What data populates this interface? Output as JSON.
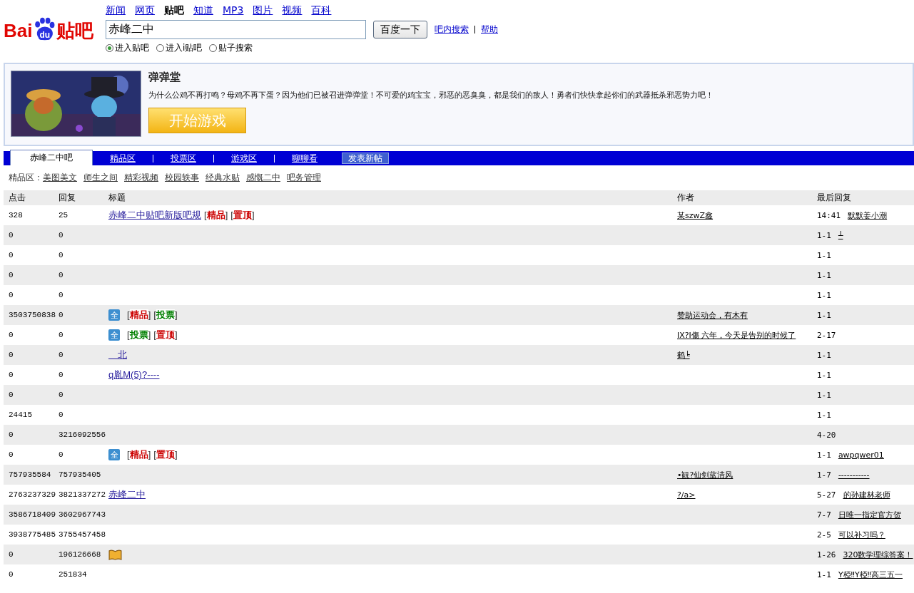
{
  "logo": {
    "left": "Bai",
    "paw": "du",
    "right": "贴吧"
  },
  "nav": [
    {
      "label": "新闻",
      "selected": false
    },
    {
      "label": "网页",
      "selected": false
    },
    {
      "label": "贴吧",
      "selected": true
    },
    {
      "label": "知道",
      "selected": false
    },
    {
      "label": "MP3",
      "selected": false
    },
    {
      "label": "图片",
      "selected": false
    },
    {
      "label": "视频",
      "selected": false
    },
    {
      "label": "百科",
      "selected": false
    }
  ],
  "search": {
    "value": "赤峰二中",
    "button": "百度一下",
    "links": [
      "吧内搜索",
      "帮助"
    ]
  },
  "radios": [
    {
      "label": "进入贴吧",
      "selected": true
    },
    {
      "label": "进入i贴吧",
      "selected": false
    },
    {
      "label": "贴子搜索",
      "selected": false
    }
  ],
  "banner": {
    "title": "弹弹堂",
    "text": "为什么公鸡不再打鸣？母鸡不再下蛋？因为他们已被召进弹弹堂！不可爱的鸡宝宝，邪恶的恶臭臭，都是我们的敌人！勇者们快快拿起你们的武器抵杀邪恶势力吧！",
    "button": "开始游戏"
  },
  "tabs": [
    {
      "label": "赤峰二中吧",
      "selected": true
    },
    {
      "label": "精品区",
      "selected": false
    },
    {
      "label": "投票区",
      "selected": false
    },
    {
      "label": "游戏区",
      "selected": false
    },
    {
      "label": "聊聊看",
      "selected": false
    }
  ],
  "post_button": "发表新帖",
  "subnav": {
    "label": "精品区：",
    "links": [
      "美图美文",
      "师生之间",
      "精彩视频",
      "校园轶事",
      "经典水贴",
      "感慨二中",
      "吧务管理"
    ]
  },
  "table": {
    "columns": [
      "点击",
      "回复",
      "标题",
      "作者",
      "最后回复"
    ],
    "rows": [
      {
        "clicks": "328",
        "replies": "25",
        "title": "赤峰二中贴吧新版吧规",
        "tags": [
          {
            "label": "[精品]",
            "color": "#cc0000"
          },
          {
            "label": "[置顶]",
            "color": "#cc0000"
          }
        ],
        "author": "某szwZ鑫",
        "time": "14:41",
        "last_user": "默默姜小潮"
      },
      {
        "clicks": "0",
        "replies": "0",
        "time": "1-1",
        "last_user": "┴"
      },
      {
        "clicks": "0",
        "replies": "0",
        "time": "1-1"
      },
      {
        "clicks": "0",
        "replies": "0",
        "time": "1-1"
      },
      {
        "clicks": "0",
        "replies": "0",
        "time": "1-1"
      },
      {
        "clicks": "3503750838",
        "replies": "0",
        "icon": {
          "kind": "badge",
          "text": "全"
        },
        "tags": [
          {
            "label": "[精品]",
            "color": "#cc0000"
          },
          {
            "label": "[投票]",
            "color": "#008000"
          }
        ],
        "author": "赞助运动会，有木有",
        "time": "1-1"
      },
      {
        "clicks": "0",
        "replies": "0",
        "icon": {
          "kind": "badge",
          "text": "全"
        },
        "tags": [
          {
            "label": "[投票]",
            "color": "#008000"
          },
          {
            "label": "[置顶]",
            "color": "#cc0000"
          }
        ],
        "author": "IX?I傷 六年，今天是告别的时候了",
        "time": "2-17"
      },
      {
        "clicks": "0",
        "replies": "0",
        "title": "　北",
        "author": "鹤╘",
        "time": "1-1"
      },
      {
        "clicks": "0",
        "replies": "0",
        "title": "q胤M(5)?----",
        "time": "1-1"
      },
      {
        "clicks": "0",
        "replies": "0",
        "time": "1-1"
      },
      {
        "clicks": "24415",
        "replies": "0",
        "time": "1-1"
      },
      {
        "clicks": "0",
        "replies": "3216092556",
        "time": "4-20"
      },
      {
        "clicks": "0",
        "replies": "0",
        "icon": {
          "kind": "badge",
          "text": "全"
        },
        "tags": [
          {
            "label": "[精品]",
            "color": "#cc0000"
          },
          {
            "label": "[置顶]",
            "color": "#cc0000"
          }
        ],
        "time": "1-1",
        "last_user": "awpqwer01"
      },
      {
        "clicks": "757935584",
        "replies": "757935405",
        "author": "•観?仙剑蓝清风",
        "time": "1-7",
        "last_user": "-----------"
      },
      {
        "clicks": "2763237329",
        "replies": "3821337272",
        "title": "赤峰二中",
        "author": "?/a>",
        "time": "5-27",
        "last_user": "的孙建林老师"
      },
      {
        "clicks": "3586718409",
        "replies": "3602967743",
        "time": "7-7",
        "last_user": "日唯一指定官方贺"
      },
      {
        "clicks": "3938775485",
        "replies": "3755457458",
        "time": "2-5",
        "last_user": "可以补习吗？"
      },
      {
        "clicks": "0",
        "replies": "196126668",
        "icon": {
          "kind": "book"
        },
        "time": "1-26",
        "last_user": "320数学理综答案！"
      },
      {
        "clicks": "0",
        "replies": "251834",
        "time": "1-1",
        "last_user": "Y椏‼Y椏‼高三五一"
      }
    ]
  }
}
